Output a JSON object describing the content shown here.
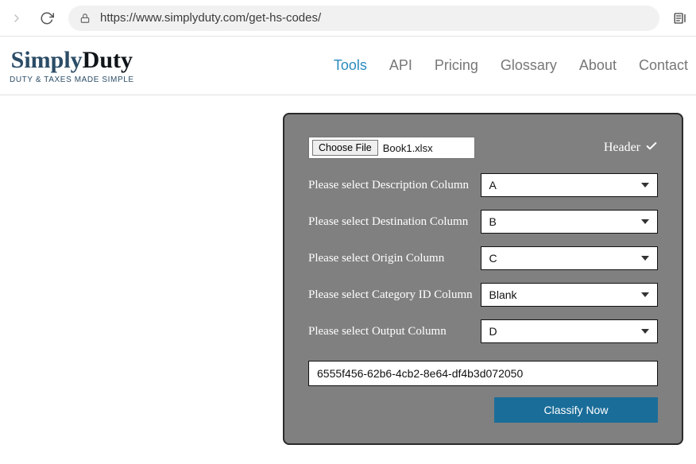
{
  "browser": {
    "url": "https://www.simplyduty.com/get-hs-codes/"
  },
  "logo": {
    "word1": "Simply",
    "word2": "Duty",
    "tagline": "DUTY & TAXES MADE SIMPLE"
  },
  "nav": {
    "tools": "Tools",
    "api": "API",
    "pricing": "Pricing",
    "glossary": "Glossary",
    "about": "About",
    "contact": "Contact"
  },
  "panel": {
    "choose_file_label": "Choose File",
    "file_name": "Book1.xlsx",
    "header_label": "Header",
    "row_description": {
      "label": "Please select Description Column",
      "value": "A"
    },
    "row_destination": {
      "label": "Please select Destination Column",
      "value": "B"
    },
    "row_origin": {
      "label": "Please select Origin Column",
      "value": "C"
    },
    "row_category": {
      "label": "Please select Category ID Column",
      "value": "Blank"
    },
    "row_output": {
      "label": "Please select Output Column",
      "value": "D"
    },
    "api_key": "6555f456-62b6-4cb2-8e64-df4b3d072050",
    "classify_label": "Classify Now"
  }
}
